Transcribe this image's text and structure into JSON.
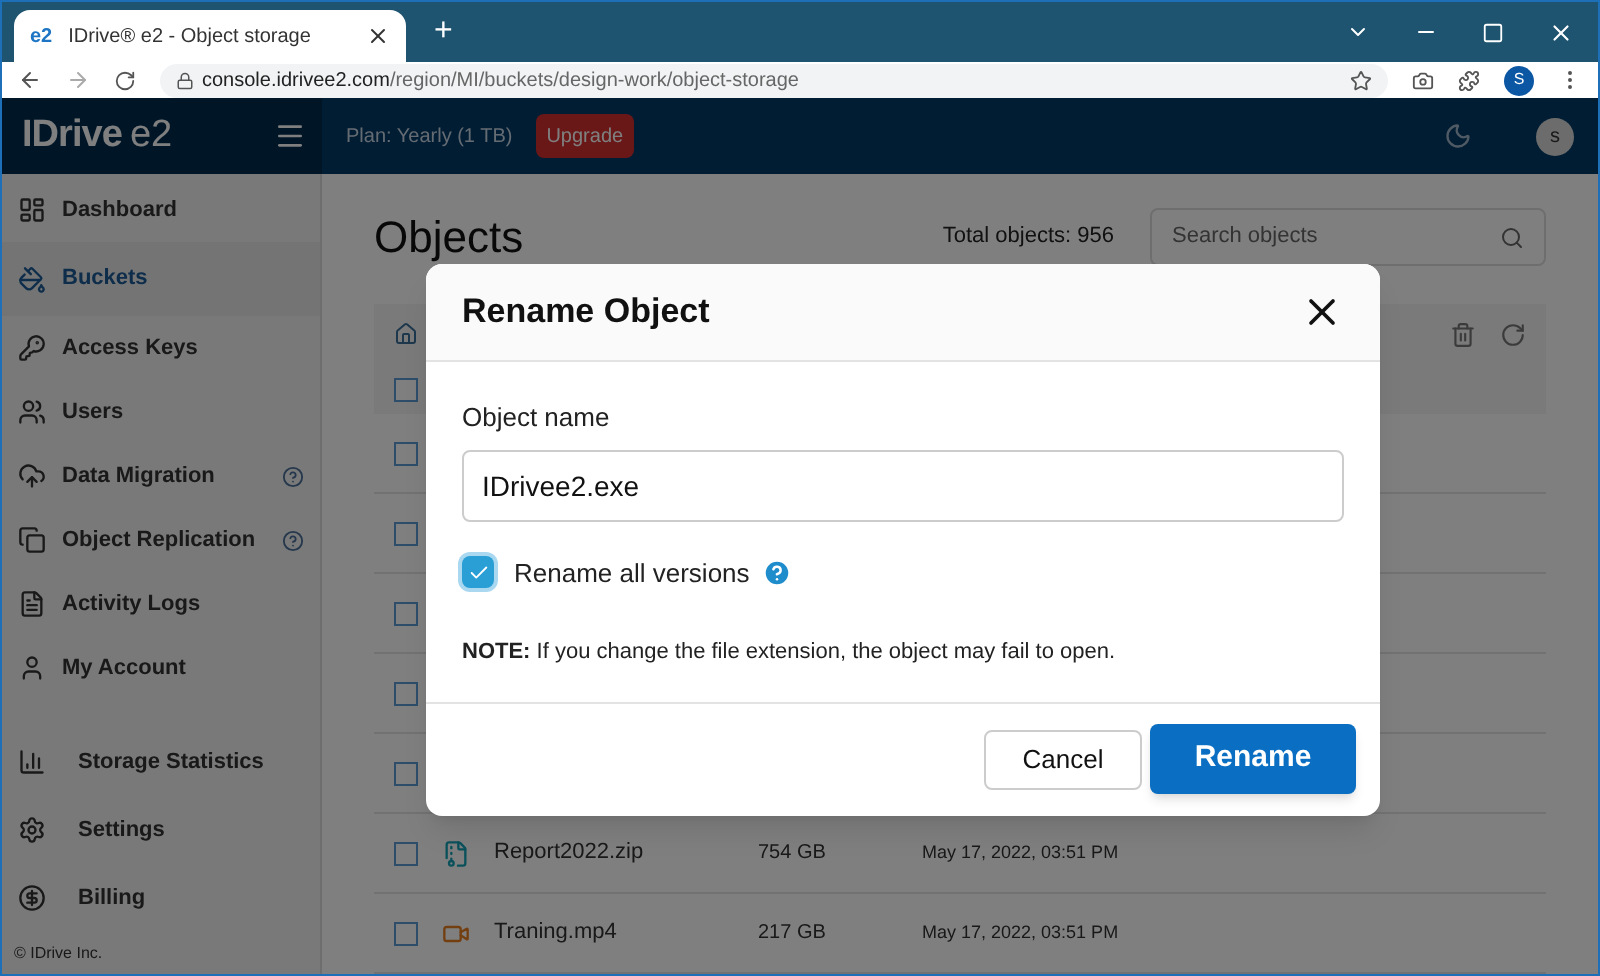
{
  "browser": {
    "tab_title": "IDrive® e2 - Object storage",
    "tab_logo": "e2",
    "new_tab": "+",
    "url_host": "console.idrivee2.com",
    "url_path": "/region/MI/buckets/design-work/object-storage",
    "profile": "S"
  },
  "header": {
    "logo": "IDrive",
    "logo_suffix": "e2",
    "plan": "Plan: Yearly (1 TB)",
    "upgrade": "Upgrade",
    "avatar": "s"
  },
  "sidebar": {
    "items": [
      {
        "label": "Dashboard",
        "selected": false,
        "help": false
      },
      {
        "label": "Buckets",
        "selected": true,
        "help": false
      },
      {
        "label": "Access Keys",
        "selected": false,
        "help": false
      },
      {
        "label": "Users",
        "selected": false,
        "help": false
      },
      {
        "label": "Data Migration",
        "selected": false,
        "help": true
      },
      {
        "label": "Object Replication",
        "selected": false,
        "help": true
      },
      {
        "label": "Activity Logs",
        "selected": false,
        "help": false
      },
      {
        "label": "My Account",
        "selected": false,
        "help": false
      }
    ],
    "bottom_items": [
      {
        "label": "Storage Statistics",
        "selected": false
      },
      {
        "label": "Settings",
        "selected": false
      },
      {
        "label": "Billing",
        "selected": false
      }
    ],
    "footer": "© IDrive Inc."
  },
  "page": {
    "title": "Objects",
    "total": "Total objects: 956",
    "search_placeholder": "Search objects"
  },
  "table": {
    "header_checked": false,
    "rows": [
      {
        "checked": false
      },
      {
        "checked": false
      },
      {
        "checked": false
      },
      {
        "checked": false
      },
      {
        "checked": false
      },
      {
        "checked": false,
        "kind": "zip",
        "name": "Report2022.zip",
        "size": "754 GB",
        "date": "May 17, 2022, 03:51 PM"
      },
      {
        "checked": false,
        "kind": "video",
        "name": "Traning.mp4",
        "size": "217 GB",
        "date": "May 17, 2022, 03:51 PM"
      }
    ]
  },
  "dialog": {
    "title": "Rename Object",
    "field_label": "Object name",
    "value": "IDrivee2.exe",
    "checkbox_label": "Rename all versions",
    "checked": true,
    "note_bold": "NOTE:",
    "note": "If you change the file extension, the object may fail to open.",
    "cancel": "Cancel",
    "confirm": "Rename"
  }
}
